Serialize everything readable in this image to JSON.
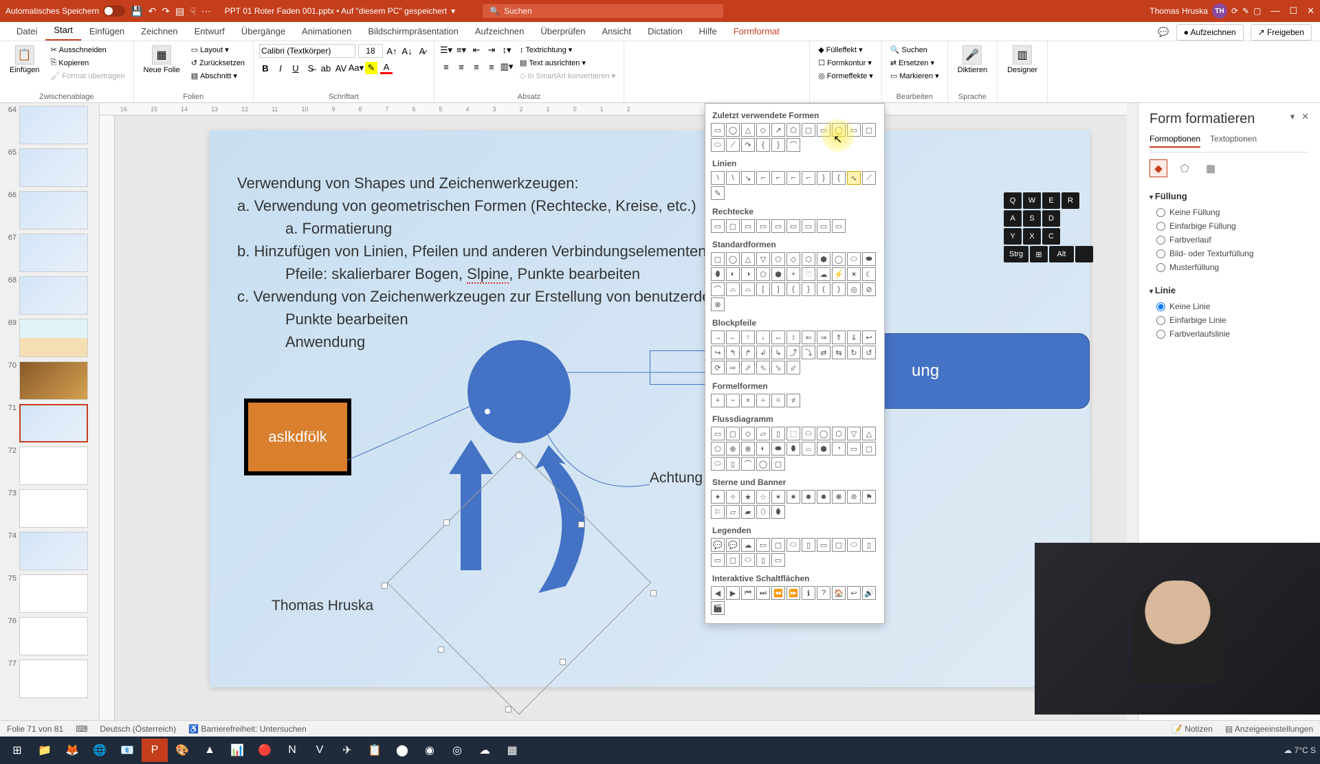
{
  "titlebar": {
    "autosave": "Automatisches Speichern",
    "filename": "PPT 01 Roter Faden 001.pptx • Auf \"diesem PC\" gespeichert",
    "search_placeholder": "Suchen",
    "user_name": "Thomas Hruska",
    "user_initials": "TH"
  },
  "tabs": {
    "datei": "Datei",
    "start": "Start",
    "einfuegen": "Einfügen",
    "zeichnen": "Zeichnen",
    "entwurf": "Entwurf",
    "uebergaenge": "Übergänge",
    "animationen": "Animationen",
    "bildschirm": "Bildschirmpräsentation",
    "aufzeichnen_tab": "Aufzeichnen",
    "ueberpruefen": "Überprüfen",
    "ansicht": "Ansicht",
    "dictation": "Dictation",
    "hilfe": "Hilfe",
    "formformat": "Formformat",
    "aufzeichnen_btn": "Aufzeichnen",
    "freigeben": "Freigeben"
  },
  "ribbon": {
    "zwischenablage": "Zwischenablage",
    "einfuegen": "Einfügen",
    "ausschneiden": "Ausschneiden",
    "kopieren": "Kopieren",
    "format_uebertragen": "Format übertragen",
    "folien": "Folien",
    "neue_folie": "Neue Folie",
    "layout": "Layout",
    "zuruecksetzen": "Zurücksetzen",
    "abschnitt": "Abschnitt",
    "schriftart": "Schriftart",
    "font_name": "Calibri (Textkörper)",
    "font_size": "18",
    "absatz": "Absatz",
    "textrichtung": "Textrichtung",
    "text_ausrichten": "Text ausrichten",
    "smartart": "In SmartArt konvertieren",
    "fuelleffekt": "Fülleffekt",
    "formkontur": "Formkontur",
    "formeffekte": "Formeffekte",
    "suchen": "Suchen",
    "ersetzen": "Ersetzen",
    "markieren": "Markieren",
    "bearbeiten": "Bearbeiten",
    "diktieren": "Diktieren",
    "sprache": "Sprache",
    "designer": "Designer"
  },
  "thumbs": [
    {
      "num": "64"
    },
    {
      "num": "65"
    },
    {
      "num": "66"
    },
    {
      "num": "67"
    },
    {
      "num": "68"
    },
    {
      "num": "69"
    },
    {
      "num": "70"
    },
    {
      "num": "71"
    },
    {
      "num": "72"
    },
    {
      "num": "73"
    },
    {
      "num": "74"
    },
    {
      "num": "75"
    },
    {
      "num": "76"
    },
    {
      "num": "77"
    }
  ],
  "slide": {
    "line1": "Verwendung von Shapes und Zeichenwerkzeugen:",
    "line2_prefix": "a.   Verwendung von geometrischen Formen (Rechtecke, Kreise, etc.)",
    "line3": "a.   Formatierung",
    "line4": "b. Hinzufügen von Linien, Pfeilen und anderen Verbindungselementen",
    "line5_a": "Pfeile: skalierbarer Bogen, ",
    "line5_b": "Slpine",
    "line5_c": ", Punkte bearbeiten",
    "line6": "c. Verwendung von Zeichenwerkzeugen zur Erstellung von benutzerdefini",
    "line7": "Punkte bearbeiten",
    "line8": "Anwendung",
    "orange_text": "aslkdfölk",
    "blue_pill_text": "ung",
    "achtung": "Achtung",
    "author": "Thomas Hruska"
  },
  "shapes_menu": {
    "recent": "Zuletzt verwendete Formen",
    "linien": "Linien",
    "rechtecke": "Rechtecke",
    "standard": "Standardformen",
    "blockpfeile": "Blockpfeile",
    "formel": "Formelformen",
    "fluss": "Flussdiagramm",
    "sterne": "Sterne und Banner",
    "legenden": "Legenden",
    "interaktiv": "Interaktive Schaltflächen"
  },
  "format_pane": {
    "title": "Form formatieren",
    "tab_form": "Formoptionen",
    "tab_text": "Textoptionen",
    "fuellung": "Füllung",
    "keine_fuellung": "Keine Füllung",
    "einfarbige_fuellung": "Einfarbige Füllung",
    "farbverlauf": "Farbverlauf",
    "bild_textur": "Bild- oder Texturfüllung",
    "musterfuellung": "Musterfüllung",
    "linie": "Linie",
    "keine_linie": "Keine Linie",
    "einfarbige_linie": "Einfarbige Linie",
    "farbverlaufslinie": "Farbverlaufslinie"
  },
  "keyboard": {
    "q": "Q",
    "w": "W",
    "e": "E",
    "a": "A",
    "s": "S",
    "d": "D",
    "y": "Y",
    "x": "X",
    "c": "C",
    "strg": "Strg",
    "alt": "Alt"
  },
  "status": {
    "slide_info": "Folie 71 von 81",
    "language": "Deutsch (Österreich)",
    "accessibility": "Barrierefreiheit: Untersuchen",
    "notizen": "Notizen",
    "anzeige": "Anzeigeeinstellungen"
  },
  "tray": {
    "temp": "7°C  S"
  }
}
